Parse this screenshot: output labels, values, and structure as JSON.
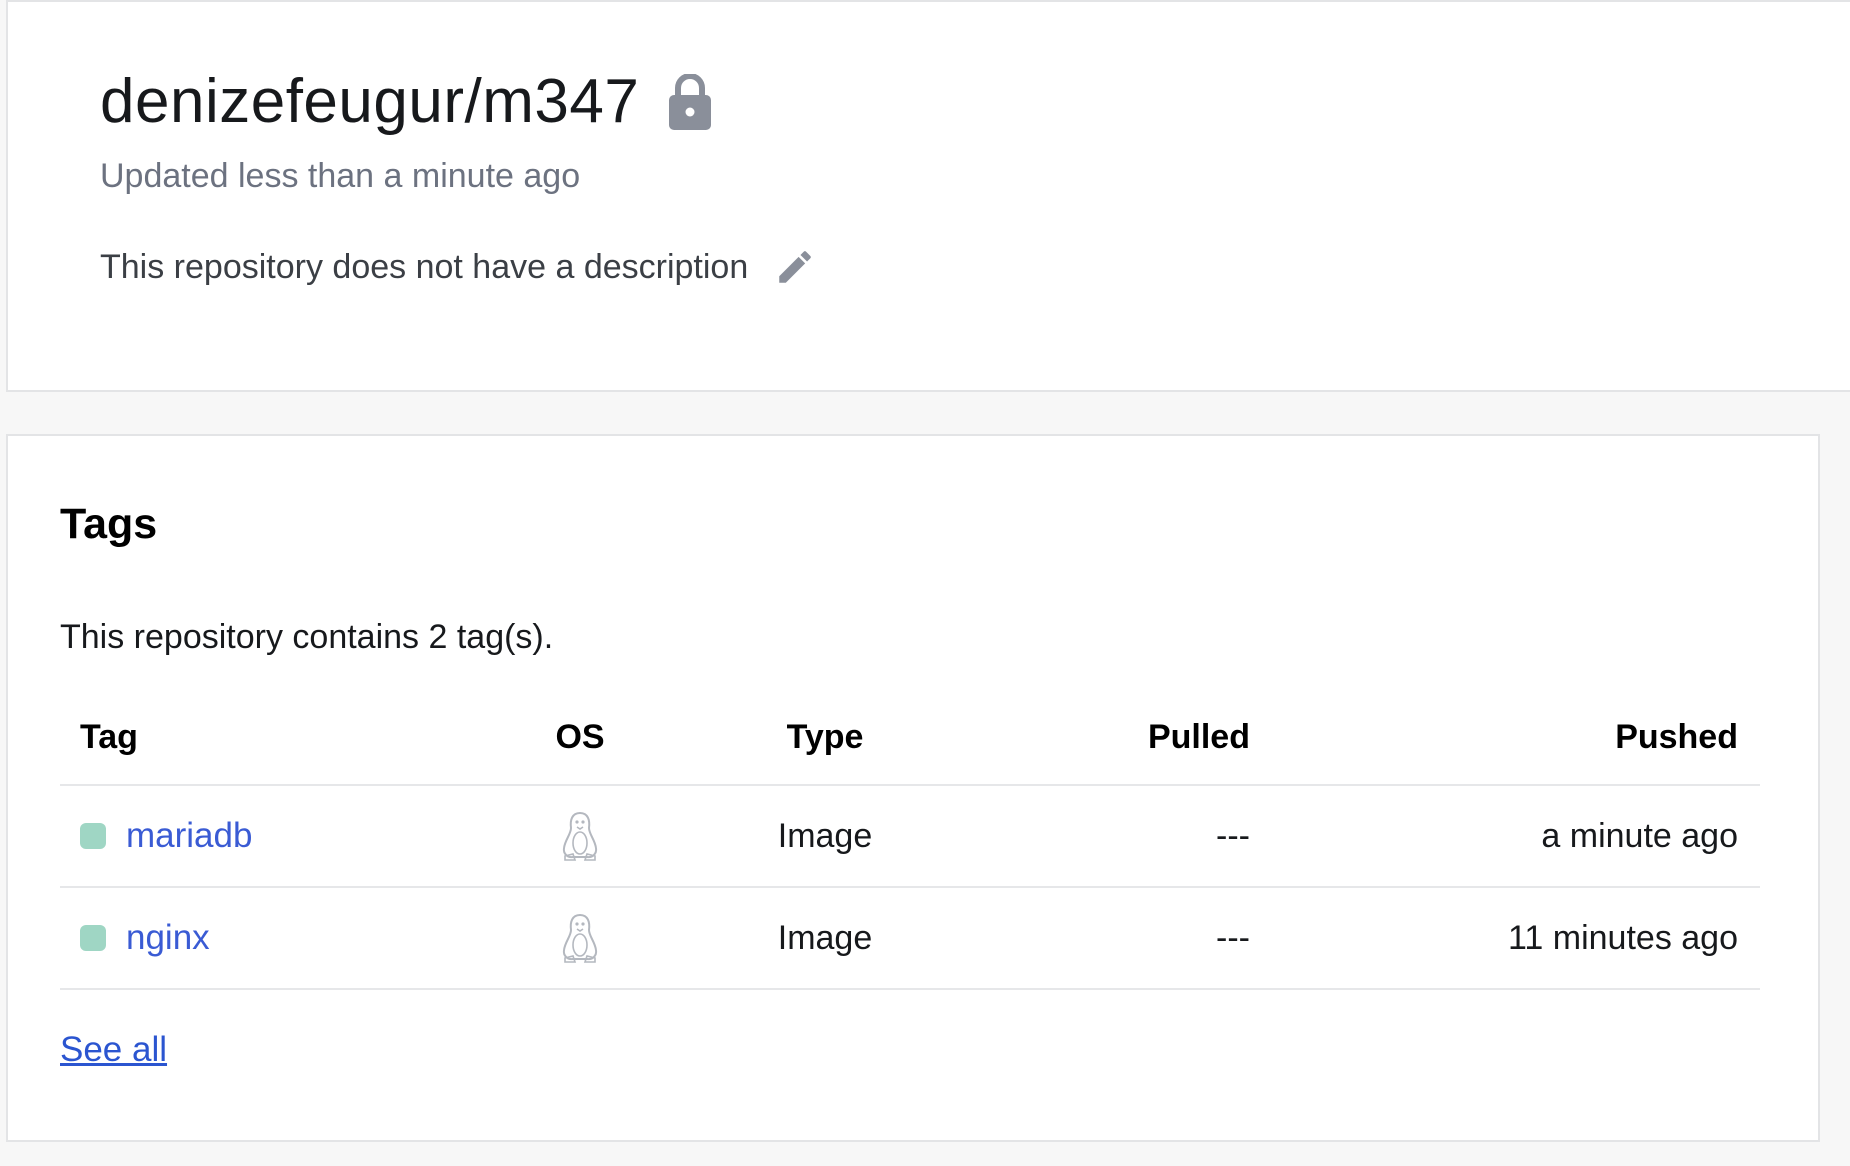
{
  "repo": {
    "name": "denizefeugur/m347",
    "updated": "Updated less than a minute ago",
    "description": "This repository does not have a description",
    "visibility_icon": "lock-icon",
    "edit_icon": "pencil-icon"
  },
  "tags": {
    "title": "Tags",
    "summary": "This repository contains 2 tag(s).",
    "columns": {
      "tag": "Tag",
      "os": "OS",
      "type": "Type",
      "pulled": "Pulled",
      "pushed": "Pushed"
    },
    "rows": [
      {
        "tag": "mariadb",
        "os_icon": "linux-icon",
        "type": "Image",
        "pulled": "---",
        "pushed": "a minute ago",
        "status_color": "#9fd6c4"
      },
      {
        "tag": "nginx",
        "os_icon": "linux-icon",
        "type": "Image",
        "pulled": "---",
        "pushed": "11 minutes ago",
        "status_color": "#9fd6c4"
      }
    ],
    "see_all": "See all"
  },
  "colors": {
    "link": "#3a5bd4",
    "muted": "#6c7280",
    "icon": "#8a8f9a"
  }
}
